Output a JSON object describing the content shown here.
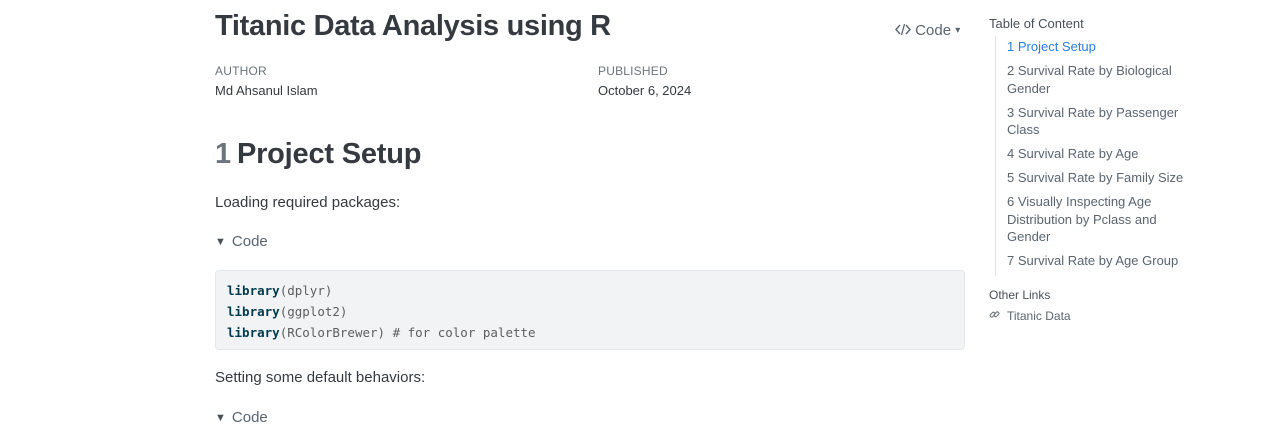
{
  "document": {
    "title": "Titanic Data Analysis using R",
    "code_toggle_label": "Code",
    "code_toggle_caret": "▾",
    "author_label": "AUTHOR",
    "author": "Md Ahsanul Islam",
    "published_label": "PUBLISHED",
    "published": "October 6, 2024"
  },
  "section": {
    "number": "1",
    "title": "Project Setup",
    "para1": "Loading required packages:",
    "details_label": "Code",
    "code_lines": [
      {
        "fn": "library",
        "arg": "(dplyr)",
        "comment": ""
      },
      {
        "fn": "library",
        "arg": "(ggplot2)",
        "comment": ""
      },
      {
        "fn": "library",
        "arg": "(RColorBrewer)",
        "comment": " # for color palette"
      }
    ],
    "para2": "Setting some default behaviors:",
    "details2_label": "Code"
  },
  "toc": {
    "title": "Table of Content",
    "items": [
      "1 Project Setup",
      "2 Survival Rate by Biological Gender",
      "3 Survival Rate by Passenger Class",
      "4 Survival Rate by Age",
      "5 Survival Rate by Family Size",
      "6 Visually Inspecting Age Distribution by Pclass and Gender",
      "7 Survival Rate by Age Group"
    ],
    "active_index": 0,
    "other_title": "Other Links",
    "other_link": "Titanic Data"
  },
  "colors": {
    "active_link": "#2780e3",
    "code_function": "#003b4f",
    "code_background": "#f1f3f5"
  }
}
